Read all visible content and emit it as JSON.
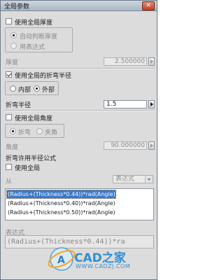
{
  "window": {
    "title": "全局参数",
    "close_glyph": "✕"
  },
  "thickness": {
    "use_global_label": "使用全局厚度",
    "auto_label": "自动判断厚度",
    "expr_label": "用表达式",
    "field_label": "厚度",
    "value": "2.500000"
  },
  "bend_radius": {
    "use_global_label": "使用全局的折弯半径",
    "inner_label": "内部",
    "outer_label": "外部",
    "field_label": "折弯半径",
    "value": "1.5"
  },
  "angle": {
    "use_global_label": "使用全局角度",
    "bend_label": "折弯",
    "corner_label": "夹角",
    "field_label": "角度",
    "value": "90.000000"
  },
  "formula": {
    "section_label": "折弯许用半径公式",
    "use_global_label": "使用全局",
    "from_label": "从",
    "select_value": "表达式",
    "items": [
      "(Radius+(Thickness*0.44))*rad(Angle)",
      "(Radius+(Thickness*0.40))*rad(Angle)",
      "(Radius+(Thickness*0.50))*rad(Angle)"
    ],
    "expr_label": "表达式",
    "expr_value": "(Radius+(Thickness*0.44))*ra"
  },
  "watermark": {
    "logo_text": "CAD之家",
    "url": "WWW.CADZJ.COM",
    "badge_glyph": "A"
  }
}
